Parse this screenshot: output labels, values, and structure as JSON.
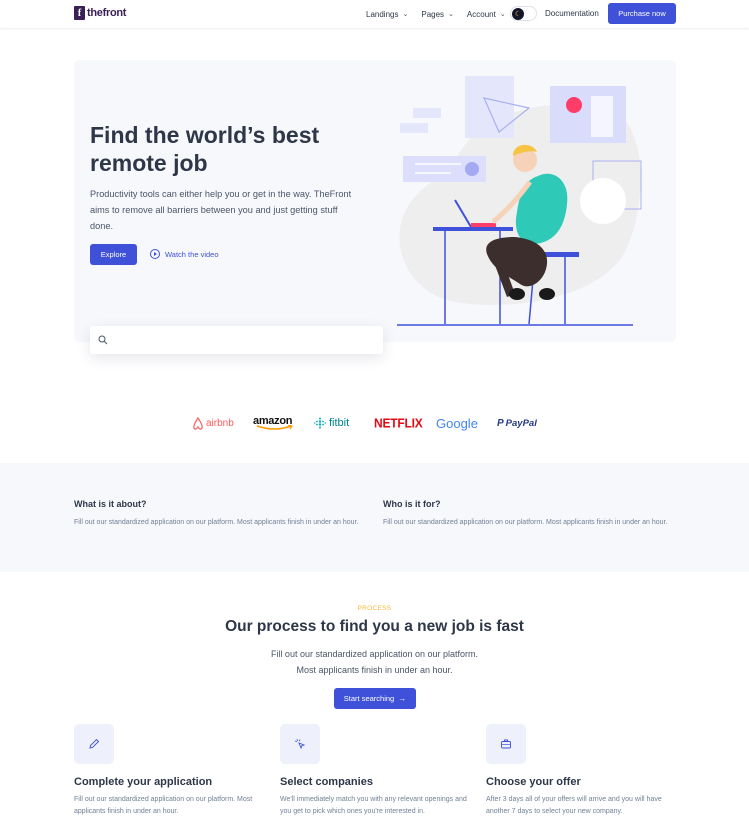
{
  "brand": {
    "logo_letter": "f",
    "name": "thefront"
  },
  "nav": {
    "items": [
      {
        "label": "Landings"
      },
      {
        "label": "Pages"
      },
      {
        "label": "Account"
      }
    ],
    "documentation": "Documentation",
    "purchase": "Purchase now"
  },
  "hero": {
    "title": "Find the world’s best remote job",
    "subtitle": "Productivity tools can either help you or get in the way. TheFront aims to remove all barriers between you and just getting stuff done.",
    "explore": "Explore",
    "watch": "Watch the video",
    "search_placeholder": ""
  },
  "logos": [
    "airbnb",
    "amazon",
    "fitbit",
    "NETFLIX",
    "Google",
    "PayPal"
  ],
  "info": {
    "left": {
      "title": "What is it about?",
      "text": "Fill out our standardized application on our platform. Most applicants finish in under an hour."
    },
    "right": {
      "title": "Who is it for?",
      "text": "Fill out our standardized application on our platform. Most applicants finish in under an hour."
    }
  },
  "process": {
    "eyebrow": "PROCESS",
    "title": "Our process to find you a new job is fast",
    "sub_line1": "Fill out our standardized application on our platform.",
    "sub_line2": "Most applicants finish in under an hour.",
    "cta": "Start searching",
    "cards": [
      {
        "icon": "pencil-icon",
        "title": "Complete your application",
        "text": "Fill out our standardized application on our platform. Most applicants finish in under an hour."
      },
      {
        "icon": "cursor-click-icon",
        "title": "Select companies",
        "text": "We'll immediately match you with any relevant openings and you get to pick which ones you're interested in."
      },
      {
        "icon": "briefcase-icon",
        "title": "Choose your offer",
        "text": "After 3 days all of your offers will arrive and you will have another 7 days to select your new company."
      }
    ]
  },
  "colors": {
    "primary": "#3f51d9",
    "accent": "#f6b93b",
    "dark": "#2d3748",
    "muted": "#718096",
    "soft_bg": "#f7f8fc"
  }
}
